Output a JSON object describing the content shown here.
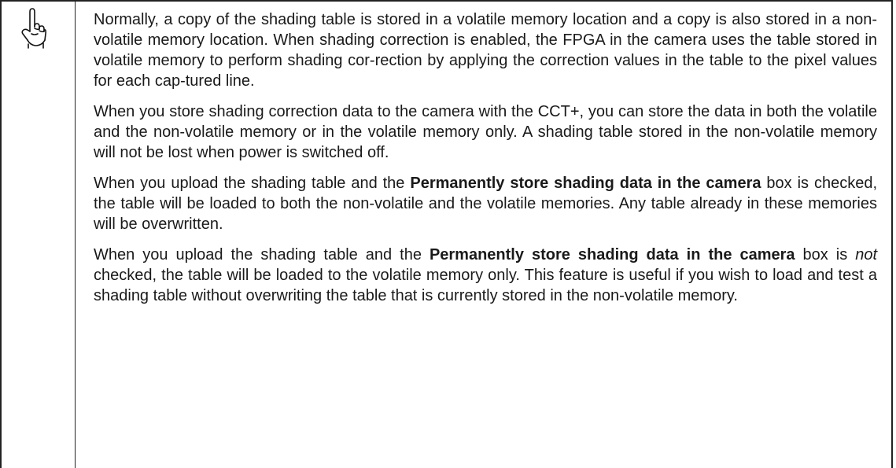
{
  "note": {
    "icon": "pointing-hand-icon",
    "paragraphs": [
      {
        "text": "Normally, a copy of the shading table is stored in a volatile memory location and a copy is also stored in a non-volatile memory location. When shading correction is enabled, the FPGA in the camera uses the table stored in volatile memory to perform shading cor-rection by applying the correction values in the table to the pixel values for each cap-tured line."
      },
      {
        "text": "When you store shading correction data to the camera with the CCT+, you can store the data in both the volatile and the non-volatile memory or in the volatile memory only. A shading  table stored in the non-volatile memory will not be lost when power is switched off."
      },
      {
        "lead": "When you upload the shading table and the ",
        "bold": "Permanently store shading data in the camera",
        "tail": " box is checked, the table will be loaded to both the non-volatile and the volatile memories. Any table already in these memories will be overwritten."
      },
      {
        "lead": "When you upload the shading table and the ",
        "bold": "Permanently store shading data in the camera",
        "mid": " box is ",
        "italic": "not",
        "tail": " checked, the table will be loaded to the volatile memory only. This feature is useful if you wish to load and test a shading table without overwriting the table that is currently stored in the non-volatile memory."
      }
    ]
  }
}
